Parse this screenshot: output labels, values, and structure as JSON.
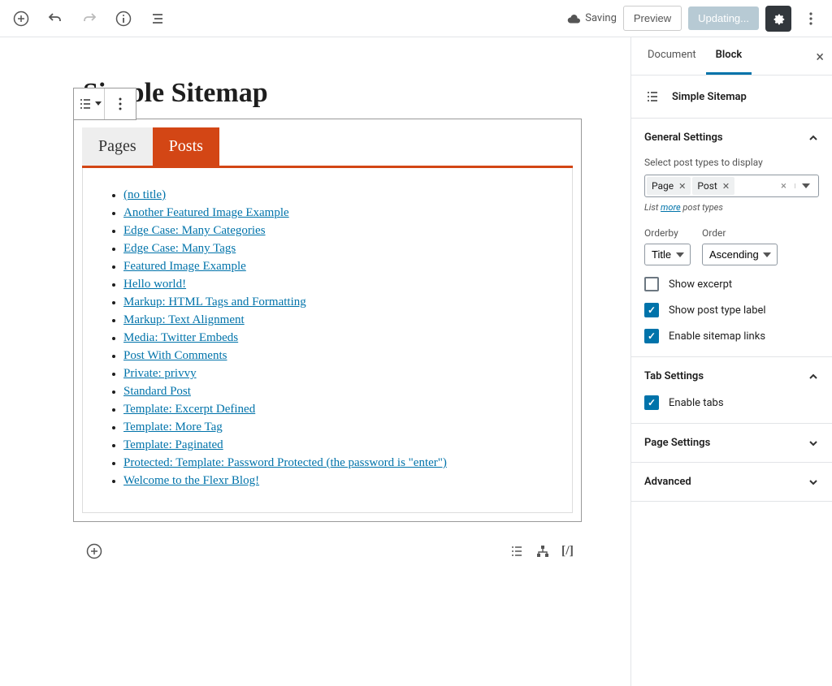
{
  "colors": {
    "accent": "#d34615",
    "primary": "#0073aa"
  },
  "toolbar": {
    "saving_text": "Saving",
    "preview_label": "Preview",
    "update_label": "Updating..."
  },
  "editor": {
    "title": "Simple Sitemap",
    "tabs": [
      {
        "label": "Pages"
      },
      {
        "label": "Posts"
      }
    ],
    "active_tab": 1,
    "sitemap_items": [
      "(no title)",
      "Another Featured Image Example",
      "Edge Case: Many Categories",
      "Edge Case: Many Tags",
      "Featured Image Example",
      "Hello world!",
      "Markup: HTML Tags and Formatting",
      "Markup: Text Alignment",
      "Media: Twitter Embeds",
      "Post With Comments",
      "Private: privvy",
      "Standard Post",
      "Template: Excerpt Defined",
      "Template: More Tag",
      "Template: Paginated",
      "Protected: Template: Password Protected (the password is \"enter\")",
      "Welcome to the Flexr Blog!"
    ],
    "bottom_shortcode": "[/]"
  },
  "sidebar": {
    "tabs": {
      "document": "Document",
      "block": "Block"
    },
    "block_name": "Simple Sitemap",
    "panels": {
      "general": {
        "title": "General Settings",
        "post_types_label": "Select post types to display",
        "tokens": [
          "Page",
          "Post"
        ],
        "list_more_pre": "List ",
        "list_more_link": "more",
        "list_more_post": " post types",
        "orderby_label": "Orderby",
        "orderby_value": "Title",
        "order_label": "Order",
        "order_value": "Ascending",
        "cb_excerpt": "Show excerpt",
        "cb_label": "Show post type label",
        "cb_links": "Enable sitemap links"
      },
      "tab_settings": {
        "title": "Tab Settings",
        "cb_enable_tabs": "Enable tabs"
      },
      "page_settings": {
        "title": "Page Settings"
      },
      "advanced": {
        "title": "Advanced"
      }
    }
  }
}
